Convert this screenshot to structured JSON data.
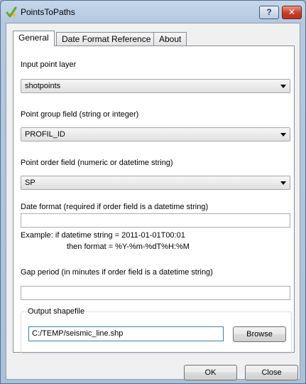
{
  "window": {
    "title": "PointsToPaths"
  },
  "titlebar": {
    "help_label": "?",
    "close_label": "✕"
  },
  "tabs": [
    {
      "label": "General"
    },
    {
      "label": "Date Format Reference"
    },
    {
      "label": "About"
    }
  ],
  "form": {
    "input_layer": {
      "label": "Input point layer",
      "value": "shotpoints"
    },
    "group_field": {
      "label": "Point group field (string or integer)",
      "value": "PROFIL_ID"
    },
    "order_field": {
      "label": "Point order field (numeric or datetime string)",
      "value": "SP"
    },
    "date_format": {
      "label": "Date format (required if order field is a datetime string)",
      "value": "",
      "example_line1": "Example:  if datetime string = 2011-01-01T00:01",
      "example_line2": "then format = %Y-%m-%dT%H:%M"
    },
    "gap_period": {
      "label": "Gap period (in minutes if order field is a datetime string)",
      "value": ""
    },
    "output": {
      "group_title": "Output shapefile",
      "path": "C:/TEMP/seismic_line.shp",
      "browse_label": "Browse"
    }
  },
  "buttons": {
    "ok_label": "OK",
    "close_label": "Close"
  }
}
